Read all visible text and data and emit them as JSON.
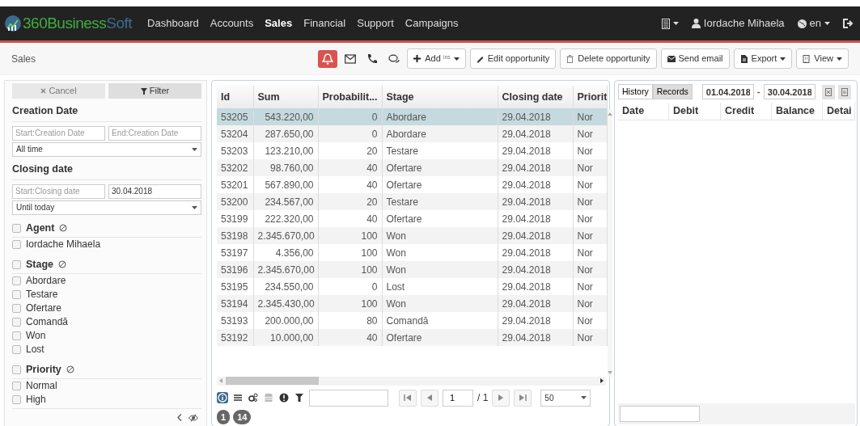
{
  "navbar": {
    "brand": [
      "360Business",
      "Soft"
    ],
    "items": [
      {
        "label": "Dashboard",
        "selected": false
      },
      {
        "label": "Accounts",
        "selected": false
      },
      {
        "label": "Sales",
        "selected": true
      },
      {
        "label": "Financial",
        "selected": false
      },
      {
        "label": "Support",
        "selected": false
      },
      {
        "label": "Campaigns",
        "selected": false
      }
    ],
    "user": "Iordache Mihaela",
    "language": "en"
  },
  "subheader": {
    "title": "Sales",
    "icon_buttons": [
      {
        "selected": true
      },
      {
        "selected": false
      },
      {
        "selected": false
      },
      {
        "selected": false
      }
    ],
    "buttons": [
      {
        "label": "Add $^{ins}$",
        "dropdown": true
      },
      {
        "label": "Edit opportunity",
        "dropdown": false
      },
      {
        "label": "Delete opportunity",
        "dropdown": false
      },
      {
        "label": "Send email",
        "dropdown": false
      },
      {
        "label": "Export",
        "dropdown": true
      },
      {
        "label": "View",
        "dropdown": true
      }
    ]
  },
  "filter_panel": {
    "cancel": "Cancel",
    "filter": "Filter",
    "date_sections": [
      {
        "title": "Creation Date",
        "start": {
          "placeholder": "Start:Creation Date"
        },
        "end": {
          "placeholder": "End:Creation Date"
        },
        "range": "All time"
      },
      {
        "title": "Closing date",
        "start": {
          "placeholder": "Start:Closing date"
        },
        "end": {
          "value": "30.04.2018"
        },
        "range": "Until today"
      }
    ],
    "groups": [
      {
        "title": "Agent",
        "checked": false,
        "items": [
          {
            "label": "Iordache Mihaela",
            "checked": false
          }
        ]
      },
      {
        "title": "Stage",
        "checked": false,
        "items": [
          {
            "label": "Abordare",
            "checked": false
          },
          {
            "label": "Testare",
            "checked": false
          },
          {
            "label": "Ofertare",
            "checked": false
          },
          {
            "label": "Comandă",
            "checked": false
          },
          {
            "label": "Won",
            "checked": false
          },
          {
            "label": "Lost",
            "checked": false
          }
        ]
      },
      {
        "title": "Priority",
        "checked": false,
        "items": [
          {
            "label": "Normal",
            "checked": false
          },
          {
            "label": "High",
            "checked": false
          }
        ]
      }
    ]
  },
  "table": {
    "columns": [
      "Id",
      "Sum",
      "Probabilit...",
      "Stage",
      "Closing date",
      "Priorit"
    ],
    "rows": [
      {
        "cells": [
          "53205",
          "543.220,00",
          "0",
          "Abordare",
          "29.04.2018",
          "Nor"
        ],
        "selected": true
      },
      {
        "cells": [
          "53204",
          "287.650,00",
          "0",
          "Abordare",
          "29.04.2018",
          "Nor"
        ],
        "selected": false
      },
      {
        "cells": [
          "53203",
          "123.210,00",
          "20",
          "Testare",
          "29.04.2018",
          "Nor"
        ],
        "selected": false
      },
      {
        "cells": [
          "53202",
          "98.760,00",
          "40",
          "Ofertare",
          "29.04.2018",
          "Nor"
        ],
        "selected": false
      },
      {
        "cells": [
          "53201",
          "567.890,00",
          "40",
          "Ofertare",
          "29.04.2018",
          "Nor"
        ],
        "selected": false
      },
      {
        "cells": [
          "53200",
          "234.567,00",
          "20",
          "Testare",
          "29.04.2018",
          "Nor"
        ],
        "selected": false
      },
      {
        "cells": [
          "53199",
          "222.320,00",
          "40",
          "Ofertare",
          "29.04.2018",
          "Nor"
        ],
        "selected": false
      },
      {
        "cells": [
          "53198",
          "2.345.670,00",
          "100",
          "Won",
          "29.04.2018",
          "Nor"
        ],
        "selected": false
      },
      {
        "cells": [
          "53197",
          "4.356,00",
          "100",
          "Won",
          "29.04.2018",
          "Nor"
        ],
        "selected": false
      },
      {
        "cells": [
          "53196",
          "2.345.670,00",
          "100",
          "Won",
          "29.04.2018",
          "Nor"
        ],
        "selected": false
      },
      {
        "cells": [
          "53195",
          "234.550,00",
          "0",
          "Lost",
          "29.04.2018",
          "Nor"
        ],
        "selected": false
      },
      {
        "cells": [
          "53194",
          "2.345.430,00",
          "100",
          "Won",
          "29.04.2018",
          "Nor"
        ],
        "selected": false
      },
      {
        "cells": [
          "53193",
          "200.000,00",
          "80",
          "Comandă",
          "29.04.2018",
          "Nor"
        ],
        "selected": false
      },
      {
        "cells": [
          "53192",
          "10.000,00",
          "40",
          "Ofertare",
          "29.04.2018",
          "Nor"
        ],
        "selected": false
      }
    ],
    "footer_tools": [
      {
        "selected": true
      },
      {
        "selected": false
      },
      {
        "selected": false
      },
      {
        "selected": false
      },
      {
        "selected": false
      },
      {
        "selected": false
      }
    ],
    "page": "1",
    "page_total": "/ 1",
    "page_size": "50",
    "badges": [
      "1",
      "14"
    ]
  },
  "records_panel": {
    "tabs": [
      {
        "label": "History",
        "selected": false
      },
      {
        "label": "Records",
        "selected": true
      }
    ],
    "date_from": "01.04.2018",
    "date_to": "30.04.2018",
    "separator": "-",
    "columns": [
      "Date",
      "Debit",
      "Credit",
      "Balance",
      "Detai"
    ]
  }
}
